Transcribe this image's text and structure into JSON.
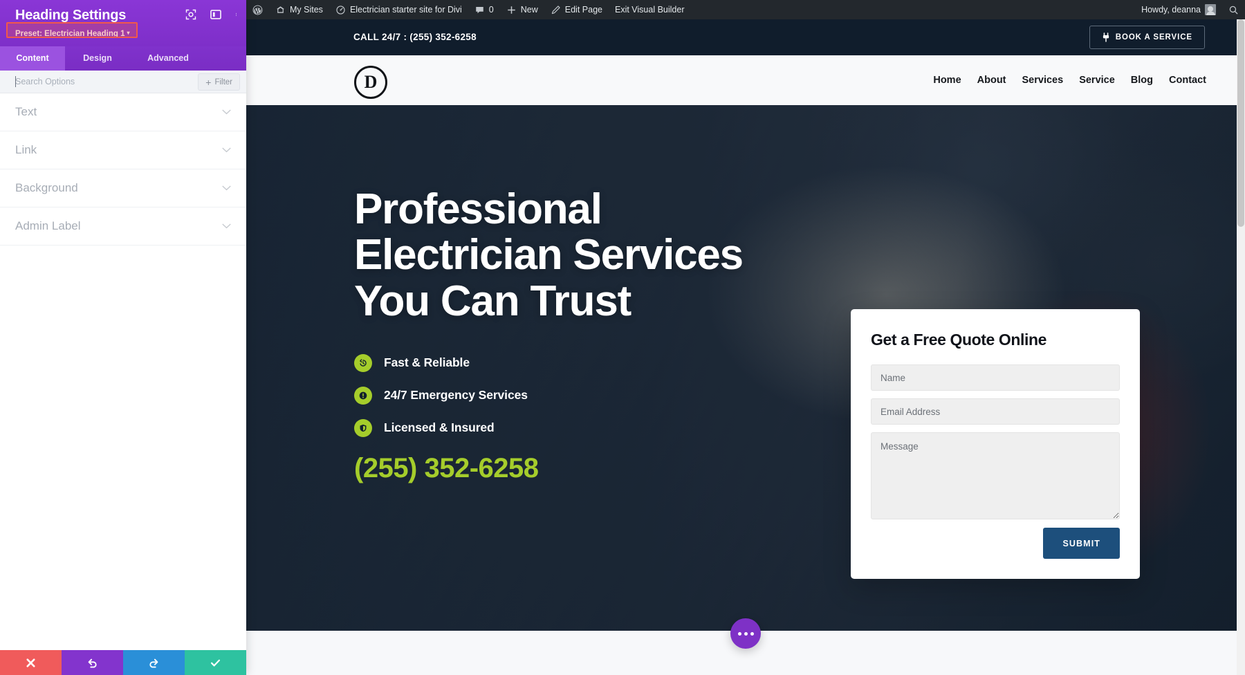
{
  "settings_panel": {
    "title": "Heading Settings",
    "preset_label": "Preset: Electrician Heading 1",
    "preset_caret": "▾",
    "tabs": [
      {
        "label": "Content",
        "active": true
      },
      {
        "label": "Design",
        "active": false
      },
      {
        "label": "Advanced",
        "active": false
      }
    ],
    "search_placeholder": "Search Options",
    "filter_label": "Filter",
    "toggles": [
      {
        "label": "Text"
      },
      {
        "label": "Link"
      },
      {
        "label": "Background"
      },
      {
        "label": "Admin Label"
      }
    ],
    "footer_buttons": [
      {
        "name": "cancel",
        "icon": "close-icon",
        "color": "#f05b5b"
      },
      {
        "name": "undo",
        "icon": "undo-icon",
        "color": "#8334cd"
      },
      {
        "name": "redo",
        "icon": "redo-icon",
        "color": "#2a8fd8"
      },
      {
        "name": "save",
        "icon": "check-icon",
        "color": "#2ec2a0"
      }
    ],
    "header_icons": [
      "target-icon",
      "panel-layout-icon",
      "kebab-menu-icon"
    ]
  },
  "admin_bar": {
    "wp_logo": "wordpress-icon",
    "my_sites": "My Sites",
    "site_name": "Electrician starter site for Divi",
    "comment_count": "0",
    "new": "New",
    "edit_page": "Edit Page",
    "exit_visual_builder": "Exit Visual Builder",
    "howdy": "Howdy, deanna",
    "search_icon": "search-icon"
  },
  "site": {
    "topbar": {
      "call_text": "CALL 24/7 : (255) 352-6258",
      "book_button": "BOOK A SERVICE",
      "book_icon": "plug-icon"
    },
    "logo_letter": "D",
    "nav_links": [
      "Home",
      "About",
      "Services",
      "Service",
      "Blog",
      "Contact"
    ],
    "hero": {
      "heading_line1": "Professional",
      "heading_line2": "Electrician Services",
      "heading_line3": "You Can Trust",
      "features": [
        {
          "icon": "clock-history-icon",
          "text": "Fast & Reliable"
        },
        {
          "icon": "exclamation-circle-icon",
          "text": "24/7 Emergency Services"
        },
        {
          "icon": "shield-check-icon",
          "text": "Licensed & Insured"
        }
      ],
      "phone": "(255) 352-6258"
    },
    "quote_form": {
      "title": "Get a Free Quote Online",
      "name_placeholder": "Name",
      "email_placeholder": "Email Address",
      "message_placeholder": "Message",
      "submit_label": "SUBMIT"
    },
    "fab": "more-options-icon"
  },
  "colors": {
    "divi_purple": "#8334cd",
    "accent_green": "#a5cd2b",
    "dark_navy": "#101d2c",
    "submit_blue": "#1d4f7c",
    "highlight_red": "#f2584a",
    "admin_bar": "#23282d"
  }
}
